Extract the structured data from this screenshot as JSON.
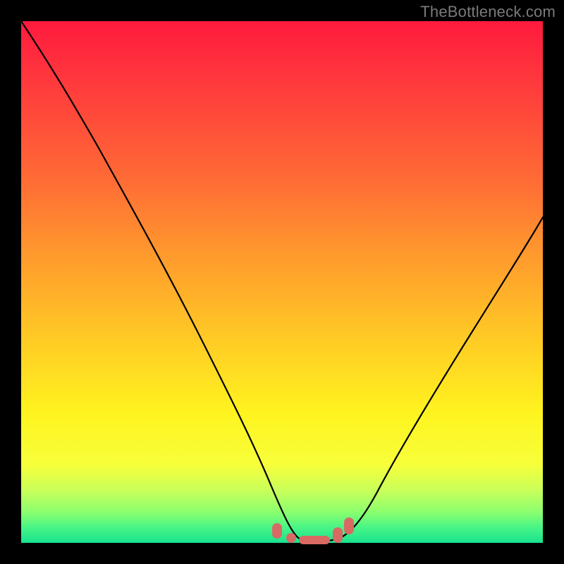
{
  "watermark": "TheBottleneck.com",
  "colors": {
    "gradient_top": "#ff1a3d",
    "gradient_mid_orange": "#ff9a2d",
    "gradient_mid_yellow": "#fff31f",
    "gradient_bottom": "#18e28e",
    "curve_stroke": "#000000",
    "bump_fill": "#d86a63",
    "frame_bg": "#000000"
  },
  "chart_data": {
    "type": "line",
    "title": "",
    "xlabel": "",
    "ylabel": "",
    "xlim": [
      0,
      100
    ],
    "ylim": [
      0,
      100
    ],
    "grid": false,
    "series": [
      {
        "name": "bottleneck-curve",
        "x": [
          0,
          4,
          10,
          16,
          22,
          28,
          34,
          40,
          44,
          48,
          51,
          54,
          58,
          62,
          66,
          72,
          80,
          88,
          96,
          100
        ],
        "y": [
          100,
          94,
          84,
          74,
          63,
          52,
          41,
          29,
          20,
          11,
          5,
          2,
          2,
          3,
          8,
          17,
          30,
          43,
          56,
          63
        ]
      }
    ],
    "annotations": [
      {
        "name": "valley-bumps",
        "x_range": [
          48,
          64
        ],
        "y": 3
      }
    ]
  }
}
